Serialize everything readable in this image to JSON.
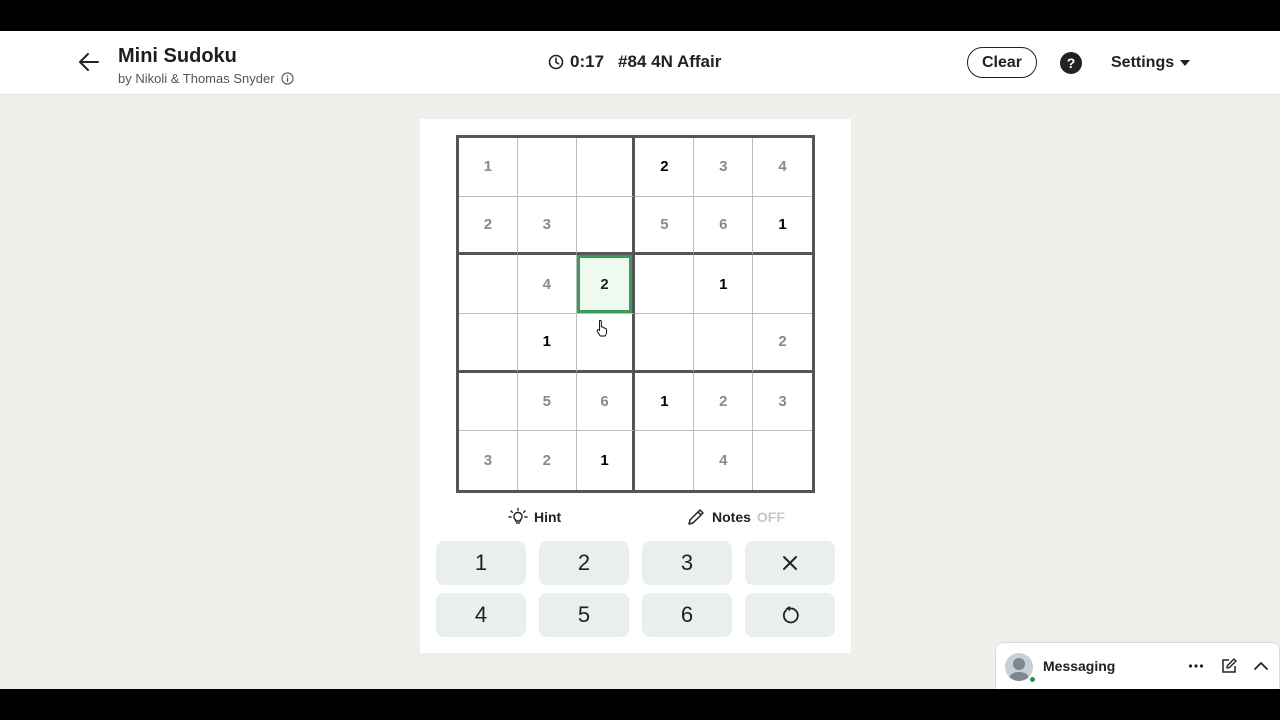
{
  "header": {
    "title": "Mini Sudoku",
    "byline": "by Nikoli & Thomas Snyder",
    "timer": "0:17",
    "puzzle": "#84 4N Affair",
    "clear_label": "Clear",
    "help_label": "?",
    "settings_label": "Settings"
  },
  "board": {
    "rows": [
      [
        {
          "v": "1",
          "t": "user"
        },
        {
          "v": "",
          "t": ""
        },
        {
          "v": "",
          "t": ""
        },
        {
          "v": "2",
          "t": "given"
        },
        {
          "v": "3",
          "t": "user"
        },
        {
          "v": "4",
          "t": "user"
        }
      ],
      [
        {
          "v": "2",
          "t": "user"
        },
        {
          "v": "3",
          "t": "user"
        },
        {
          "v": "",
          "t": ""
        },
        {
          "v": "5",
          "t": "user"
        },
        {
          "v": "6",
          "t": "user"
        },
        {
          "v": "1",
          "t": "given"
        }
      ],
      [
        {
          "v": "",
          "t": ""
        },
        {
          "v": "4",
          "t": "user"
        },
        {
          "v": "2",
          "t": "selected"
        },
        {
          "v": "",
          "t": ""
        },
        {
          "v": "1",
          "t": "given"
        },
        {
          "v": "",
          "t": ""
        }
      ],
      [
        {
          "v": "",
          "t": ""
        },
        {
          "v": "1",
          "t": "given"
        },
        {
          "v": "",
          "t": ""
        },
        {
          "v": "",
          "t": ""
        },
        {
          "v": "",
          "t": ""
        },
        {
          "v": "2",
          "t": "user"
        }
      ],
      [
        {
          "v": "",
          "t": ""
        },
        {
          "v": "5",
          "t": "user"
        },
        {
          "v": "6",
          "t": "user"
        },
        {
          "v": "1",
          "t": "given"
        },
        {
          "v": "2",
          "t": "user"
        },
        {
          "v": "3",
          "t": "user"
        }
      ],
      [
        {
          "v": "3",
          "t": "user"
        },
        {
          "v": "2",
          "t": "user"
        },
        {
          "v": "1",
          "t": "given"
        },
        {
          "v": "",
          "t": ""
        },
        {
          "v": "4",
          "t": "user"
        },
        {
          "v": "",
          "t": ""
        }
      ]
    ]
  },
  "tools": {
    "hint_label": "Hint",
    "notes_label": "Notes",
    "notes_state": "OFF"
  },
  "keypad": {
    "keys": [
      "1",
      "2",
      "3",
      "erase",
      "4",
      "5",
      "6",
      "undo"
    ],
    "labels": {
      "k1": "1",
      "k2": "2",
      "k3": "3",
      "k4": "4",
      "k5": "5",
      "k6": "6"
    }
  },
  "messaging": {
    "label": "Messaging"
  },
  "colors": {
    "selected_border": "#3e9a5b",
    "selected_fill": "#eef9f0",
    "key_bg": "#e8efec",
    "page_bg": "#f1efeb",
    "presence": "#2f8f4e"
  },
  "icons": {
    "back": "arrow-left-icon",
    "info": "info-icon",
    "timer": "clock-icon",
    "help": "question-icon",
    "settings": "caret-down-icon",
    "hint": "lightbulb-icon",
    "notes": "pencil-icon",
    "erase": "x-icon",
    "undo": "undo-icon",
    "more": "ellipsis-icon",
    "compose": "compose-icon",
    "expand": "chevron-up-icon"
  }
}
